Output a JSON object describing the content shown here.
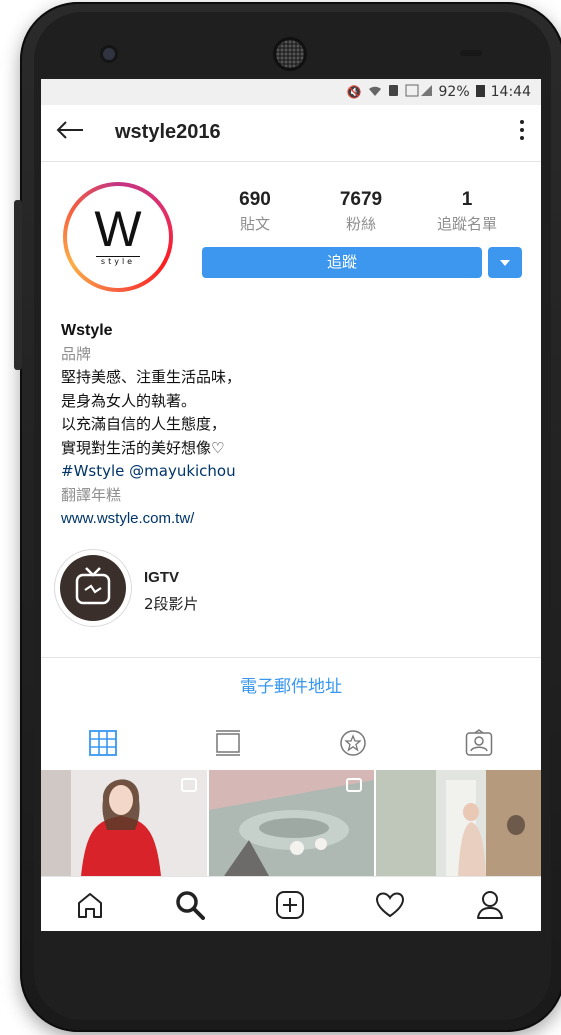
{
  "status_bar": {
    "battery": "92%",
    "time": "14:44"
  },
  "header": {
    "back_icon": "arrow-left-icon",
    "username": "wstyle2016",
    "menu_icon": "more-vertical-icon"
  },
  "profile": {
    "avatar_letter": "W",
    "avatar_sub": "style",
    "stats": [
      {
        "value": "690",
        "label": "貼文"
      },
      {
        "value": "7679",
        "label": "粉絲"
      },
      {
        "value": "1",
        "label": "追蹤名單"
      }
    ],
    "follow_label": "追蹤",
    "dropdown_icon": "caret-down-icon"
  },
  "bio": {
    "name": "Wstyle",
    "category": "品牌",
    "lines": [
      "堅持美感、注重生活品味，",
      "是身為女人的執著。",
      "以充滿自信的人生態度，",
      "實現對生活的美好想像♡"
    ],
    "tags": "#Wstyle @mayukichou",
    "translate": "翻譯年糕",
    "link": "www.wstyle.com.tw/"
  },
  "highlight": {
    "title": "IGTV",
    "count": "2段影片"
  },
  "email_button": "電子郵件地址",
  "colors": {
    "accent": "#3d97ee",
    "link": "#003569",
    "muted": "#8e8e8e"
  }
}
